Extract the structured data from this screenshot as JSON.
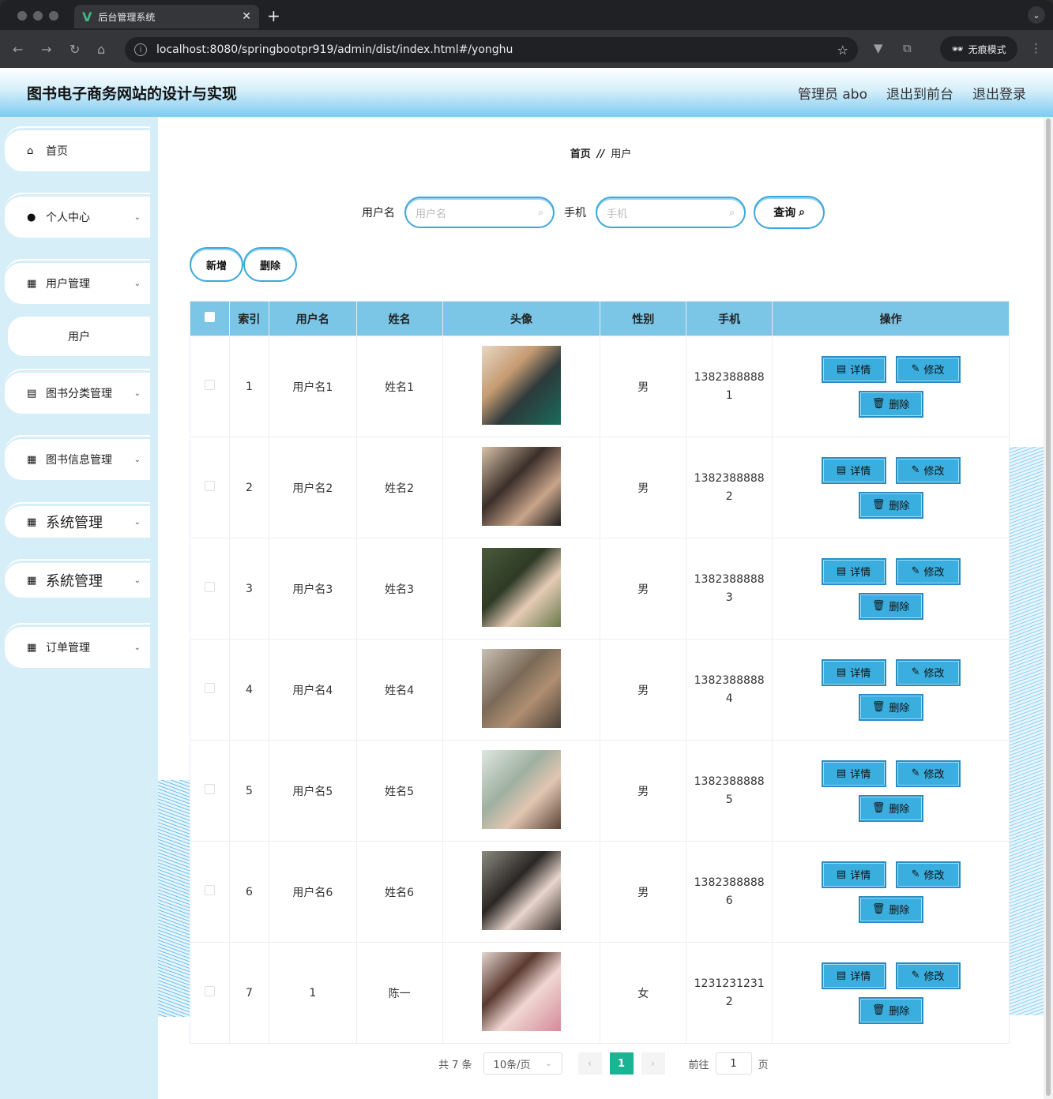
{
  "browser": {
    "tab_title": "后台管理系统",
    "url": "localhost:8080/springbootpr919/admin/dist/index.html#/yonghu",
    "incognito_label": "无痕模式"
  },
  "header": {
    "title": "图书电子商务网站的设计与实现",
    "admin_label": "管理员 abo",
    "back_to_front": "退出到前台",
    "logout": "退出登录"
  },
  "sidebar": {
    "items": [
      {
        "label": "首页",
        "icon": "home-icon"
      },
      {
        "label": "个人中心",
        "icon": "user-icon"
      },
      {
        "label": "用户管理",
        "icon": "grid-icon"
      },
      {
        "label": "用户",
        "icon": ""
      },
      {
        "label": "图书分类管理",
        "icon": "clipboard-icon"
      },
      {
        "label": "图书信息管理",
        "icon": "grid-icon"
      },
      {
        "label": "系统管理",
        "icon": "grid-icon"
      },
      {
        "label": "系統管理",
        "icon": "grid-icon"
      },
      {
        "label": "订单管理",
        "icon": "grid-icon"
      }
    ]
  },
  "breadcrumb": {
    "home": "首页",
    "separator": "//",
    "current": "用户"
  },
  "search": {
    "username_label": "用户名",
    "username_placeholder": "用户名",
    "phone_label": "手机",
    "phone_placeholder": "手机",
    "query_button": "查询"
  },
  "actions": {
    "add": "新增",
    "delete": "删除"
  },
  "table": {
    "headers": [
      "索引",
      "用户名",
      "姓名",
      "头像",
      "性别",
      "手机",
      "操作"
    ],
    "row_buttons": {
      "detail": "详情",
      "edit": "修改",
      "delete": "删除"
    },
    "rows": [
      {
        "index": "1",
        "username": "用户名1",
        "name": "姓名1",
        "gender": "男",
        "phone": "13823888881"
      },
      {
        "index": "2",
        "username": "用户名2",
        "name": "姓名2",
        "gender": "男",
        "phone": "1382388888 2"
      },
      {
        "index": "3",
        "username": "用户名3",
        "name": "姓名3",
        "gender": "男",
        "phone": "1382388888 3"
      },
      {
        "index": "4",
        "username": "用户名4",
        "name": "姓名4",
        "gender": "男",
        "phone": "1382388888 4"
      },
      {
        "index": "5",
        "username": "用户名5",
        "name": "姓名5",
        "gender": "男",
        "phone": "1382388888 5"
      },
      {
        "index": "6",
        "username": "用户名6",
        "name": "姓名6",
        "gender": "男",
        "phone": "1382388888 6"
      },
      {
        "index": "7",
        "username": "1",
        "name": "陈一",
        "gender": "女",
        "phone": "12312312312"
      }
    ]
  },
  "pagination": {
    "total": "共 7 条",
    "page_size": "10条/页",
    "current_page": "1",
    "goto_label": "前往",
    "goto_value": "1",
    "page_suffix": "页"
  },
  "colors": {
    "accent": "#3aaedf",
    "header": "#7bc5e6",
    "pager_active": "#1ab394"
  }
}
